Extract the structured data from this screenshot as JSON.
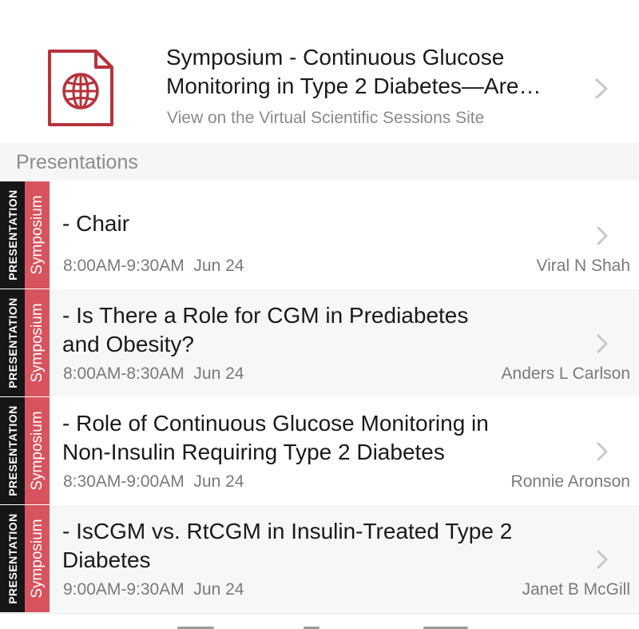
{
  "header": {
    "title_line1": "Symposium - Continuous Glucose",
    "title_line2": "Monitoring in Type 2 Diabetes—Are…",
    "subtitle": "View on the Virtual Scientific Sessions Site",
    "icon": "globe-document-icon",
    "accent_color": "#b5333c"
  },
  "section": {
    "label": "Presentations"
  },
  "presentations": [
    {
      "type_label": "PRESENTATION",
      "category_label": "Symposium",
      "title": "- Chair",
      "time": "8:00AM-9:30AM  Jun 24",
      "person": "Viral N Shah"
    },
    {
      "type_label": "PRESENTATION",
      "category_label": "Symposium",
      "title": "- Is There a Role for CGM in Prediabetes and Obesity?",
      "time": "8:00AM-8:30AM  Jun 24",
      "person": "Anders L Carlson"
    },
    {
      "type_label": "PRESENTATION",
      "category_label": "Symposium",
      "title": "- Role of Continuous Glucose Monitoring in Non-Insulin Requiring Type 2 Diabetes",
      "time": "8:30AM-9:00AM  Jun 24",
      "person": "Ronnie Aronson"
    },
    {
      "type_label": "PRESENTATION",
      "category_label": "Symposium",
      "title": "- IsCGM vs. RtCGM in Insulin-Treated Type 2 Diabetes",
      "time": "9:00AM-9:30AM  Jun 24",
      "person": "Janet B McGill"
    }
  ],
  "colors": {
    "category_tag": "#d7535e",
    "type_tag": "#161616",
    "chevron": "#c7c7cc"
  }
}
